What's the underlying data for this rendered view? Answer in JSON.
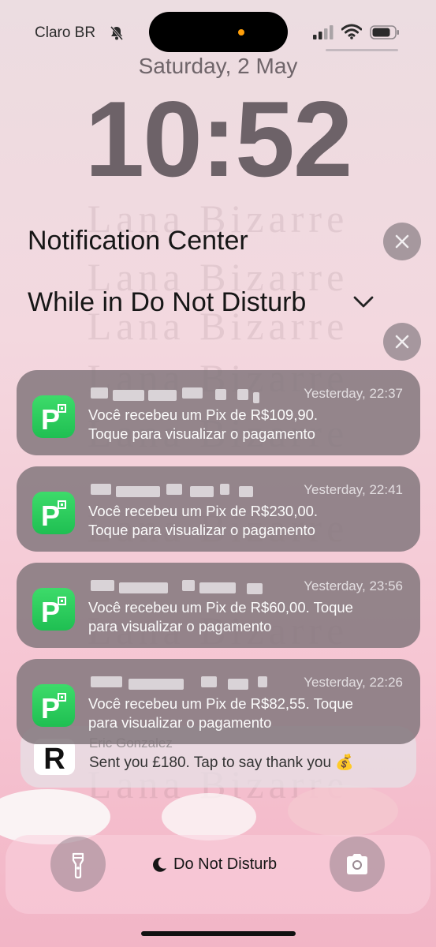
{
  "status_bar": {
    "carrier": "Claro BR",
    "icons": [
      "bell-slash-icon",
      "cellular-signal-icon",
      "wifi-icon",
      "battery-icon"
    ]
  },
  "lock_screen": {
    "date": "Saturday, 2 May",
    "time": "10:52"
  },
  "watermark": "Lana Bizarre",
  "notification_center": {
    "title": "Notification Center",
    "group_title": "While in Do Not Disturb",
    "notifications": [
      {
        "app_icon": "picpay-icon",
        "time": "Yesterday, 22:37",
        "message": "Você recebeu um Pix de R$109,90.",
        "message_line2": "Toque para visualizar o pagamento"
      },
      {
        "app_icon": "picpay-icon",
        "time": "Yesterday, 22:41",
        "message": "Você recebeu um Pix de R$230,00.",
        "message_line2": "Toque para visualizar o pagamento"
      },
      {
        "app_icon": "picpay-icon",
        "time": "Yesterday, 23:56",
        "message": "Você recebeu um Pix de R$60,00. Toque",
        "message_line2": "para visualizar o pagamento"
      },
      {
        "app_icon": "picpay-icon",
        "time": "Yesterday, 22:26",
        "message": "Você recebeu um Pix de R$82,55. Toque",
        "message_line2": "para visualizar o pagamento"
      }
    ],
    "revolut_notification": {
      "app_icon": "revolut-icon",
      "sender": "Eric Gonzalez",
      "message": "Sent you £180. Tap to say thank you 💰"
    }
  },
  "bottom_bar": {
    "focus_label": "Do Not Disturb",
    "left_button_icon": "flashlight-icon",
    "right_button_icon": "camera-icon"
  },
  "colors": {
    "picpay_green": "#21c25e",
    "card_bg": "#84787e",
    "accent_orange": "#ff9f0a"
  }
}
